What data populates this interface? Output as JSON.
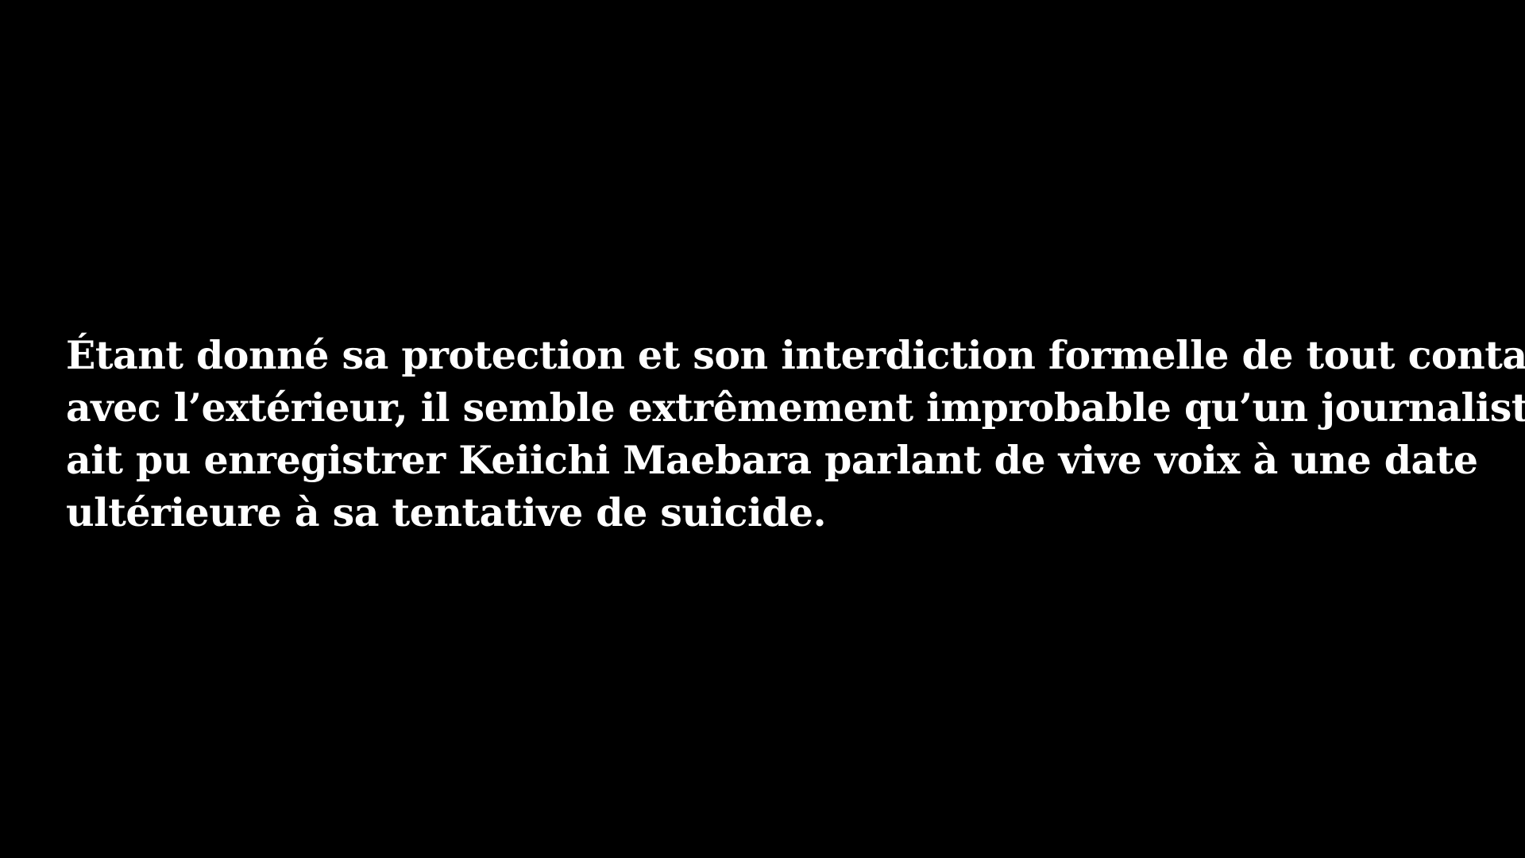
{
  "caption": {
    "lines": [
      "Étant donné sa protection et son interdiction formelle de tout contact",
      "avec l’extérieur, il semble extrêmement improbable qu’un journaliste",
      "ait pu enregistrer Keiichi Maebara parlant de vive voix à une date",
      "ultérieure à sa tentative de suicide."
    ]
  },
  "colors": {
    "background": "#000000",
    "text": "#ffffff"
  }
}
